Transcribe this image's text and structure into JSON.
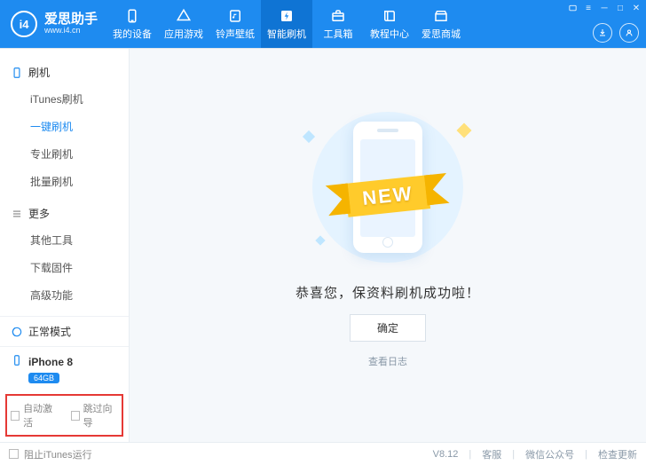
{
  "brand": {
    "logo_text": "i4",
    "title": "爱思助手",
    "sub": "www.i4.cn"
  },
  "nav": [
    {
      "label": "我的设备",
      "icon": "phone"
    },
    {
      "label": "应用游戏",
      "icon": "apps"
    },
    {
      "label": "铃声壁纸",
      "icon": "music"
    },
    {
      "label": "智能刷机",
      "icon": "flash",
      "active": true
    },
    {
      "label": "工具箱",
      "icon": "toolbox"
    },
    {
      "label": "教程中心",
      "icon": "book"
    },
    {
      "label": "爱思商城",
      "icon": "store"
    }
  ],
  "header_right": {
    "download": "download",
    "user": "user"
  },
  "sidebar": {
    "groups": [
      {
        "title": "刷机",
        "items": [
          {
            "label": "iTunes刷机"
          },
          {
            "label": "一键刷机",
            "active": true
          },
          {
            "label": "专业刷机"
          },
          {
            "label": "批量刷机"
          }
        ]
      },
      {
        "title": "更多",
        "items": [
          {
            "label": "其他工具"
          },
          {
            "label": "下载固件"
          },
          {
            "label": "高级功能"
          }
        ]
      }
    ],
    "mode": "正常模式",
    "device": {
      "name": "iPhone 8",
      "storage": "64GB"
    },
    "checks": {
      "auto_activate": "自动激活",
      "skip_guide": "跳过向导"
    }
  },
  "main": {
    "ribbon": "NEW",
    "success": "恭喜您，保资料刷机成功啦！",
    "ok": "确定",
    "view_log": "查看日志"
  },
  "footer": {
    "block_itunes": "阻止iTunes运行",
    "version": "V8.12",
    "support": "客服",
    "wechat": "微信公众号",
    "update": "检查更新"
  }
}
